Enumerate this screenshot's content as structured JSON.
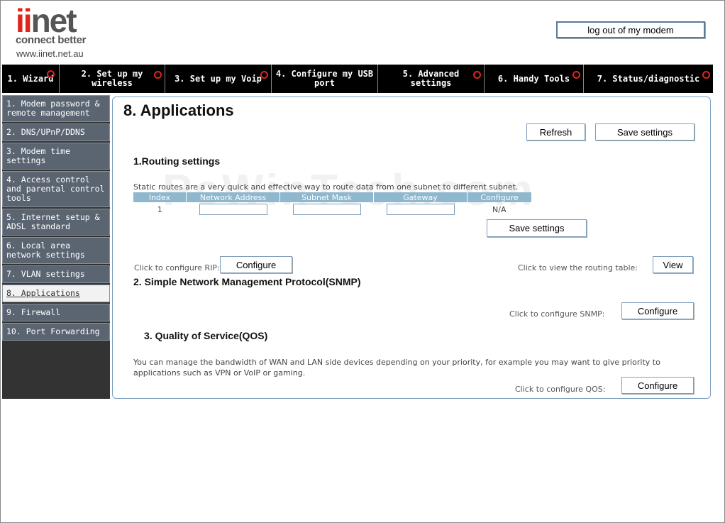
{
  "brand": {
    "logo_prefix": "ii",
    "logo_suffix": "net",
    "tagline": "connect better",
    "url": "www.iinet.net.au"
  },
  "header": {
    "logout_label": "log out of my modem"
  },
  "topnav": {
    "tabs": [
      {
        "label": "1. Wizard"
      },
      {
        "label": "2. Set up my wireless"
      },
      {
        "label": "3. Set up my Voip"
      },
      {
        "label": "4. Configure my USB port"
      },
      {
        "label": "5. Advanced settings"
      },
      {
        "label": "6. Handy Tools"
      },
      {
        "label": "7. Status/diagnostic"
      }
    ]
  },
  "sidebar": {
    "items": [
      {
        "label": "1. Modem password & remote management"
      },
      {
        "label": "2. DNS/UPnP/DDNS"
      },
      {
        "label": "3. Modem time settings"
      },
      {
        "label": "4. Access control and parental control tools"
      },
      {
        "label": "5. Internet setup & ADSL standard"
      },
      {
        "label": "6. Local area network settings"
      },
      {
        "label": "7. VLAN settings"
      },
      {
        "label": "8. Applications"
      },
      {
        "label": "9. Firewall"
      },
      {
        "label": "10. Port Forwarding"
      }
    ]
  },
  "main": {
    "title": "8. Applications",
    "refresh_label": "Refresh",
    "save_label": "Save settings",
    "routing": {
      "heading": "1.Routing settings",
      "description": "Static routes are a very quick and effective way to route data from one subnet to different subnet.",
      "columns": [
        "Index",
        "Network Address",
        "Subnet Mask",
        "Gateway",
        "Configure"
      ],
      "row": {
        "index": "1",
        "network_address": "",
        "subnet_mask": "",
        "gateway": "",
        "configure": "N/A"
      },
      "save_label": "Save settings",
      "rip_text": "Click to configure RIP:",
      "rip_button": "Configure",
      "view_text": "Click to view the routing table:",
      "view_button": "View"
    },
    "snmp": {
      "heading": "2. Simple Network Management Protocol(SNMP)",
      "text": "Click to configure SNMP:",
      "button": "Configure"
    },
    "qos": {
      "heading": "3. Quality of Service(QOS)",
      "description": "You can manage the bandwidth of WAN and LAN side devices depending on your priority, for example you may want to give priority to applications such as VPN or VoIP or gaming.",
      "text": "Click to configure QOS:",
      "button": "Configure"
    }
  },
  "watermark": "PcWinTech.com",
  "colors": {
    "brand_red": "#e2231a",
    "nav_bg": "#000000",
    "sidebar_item": "#5b6572",
    "table_header": "#8fb7cd",
    "panel_border": "#7aa0bf"
  }
}
